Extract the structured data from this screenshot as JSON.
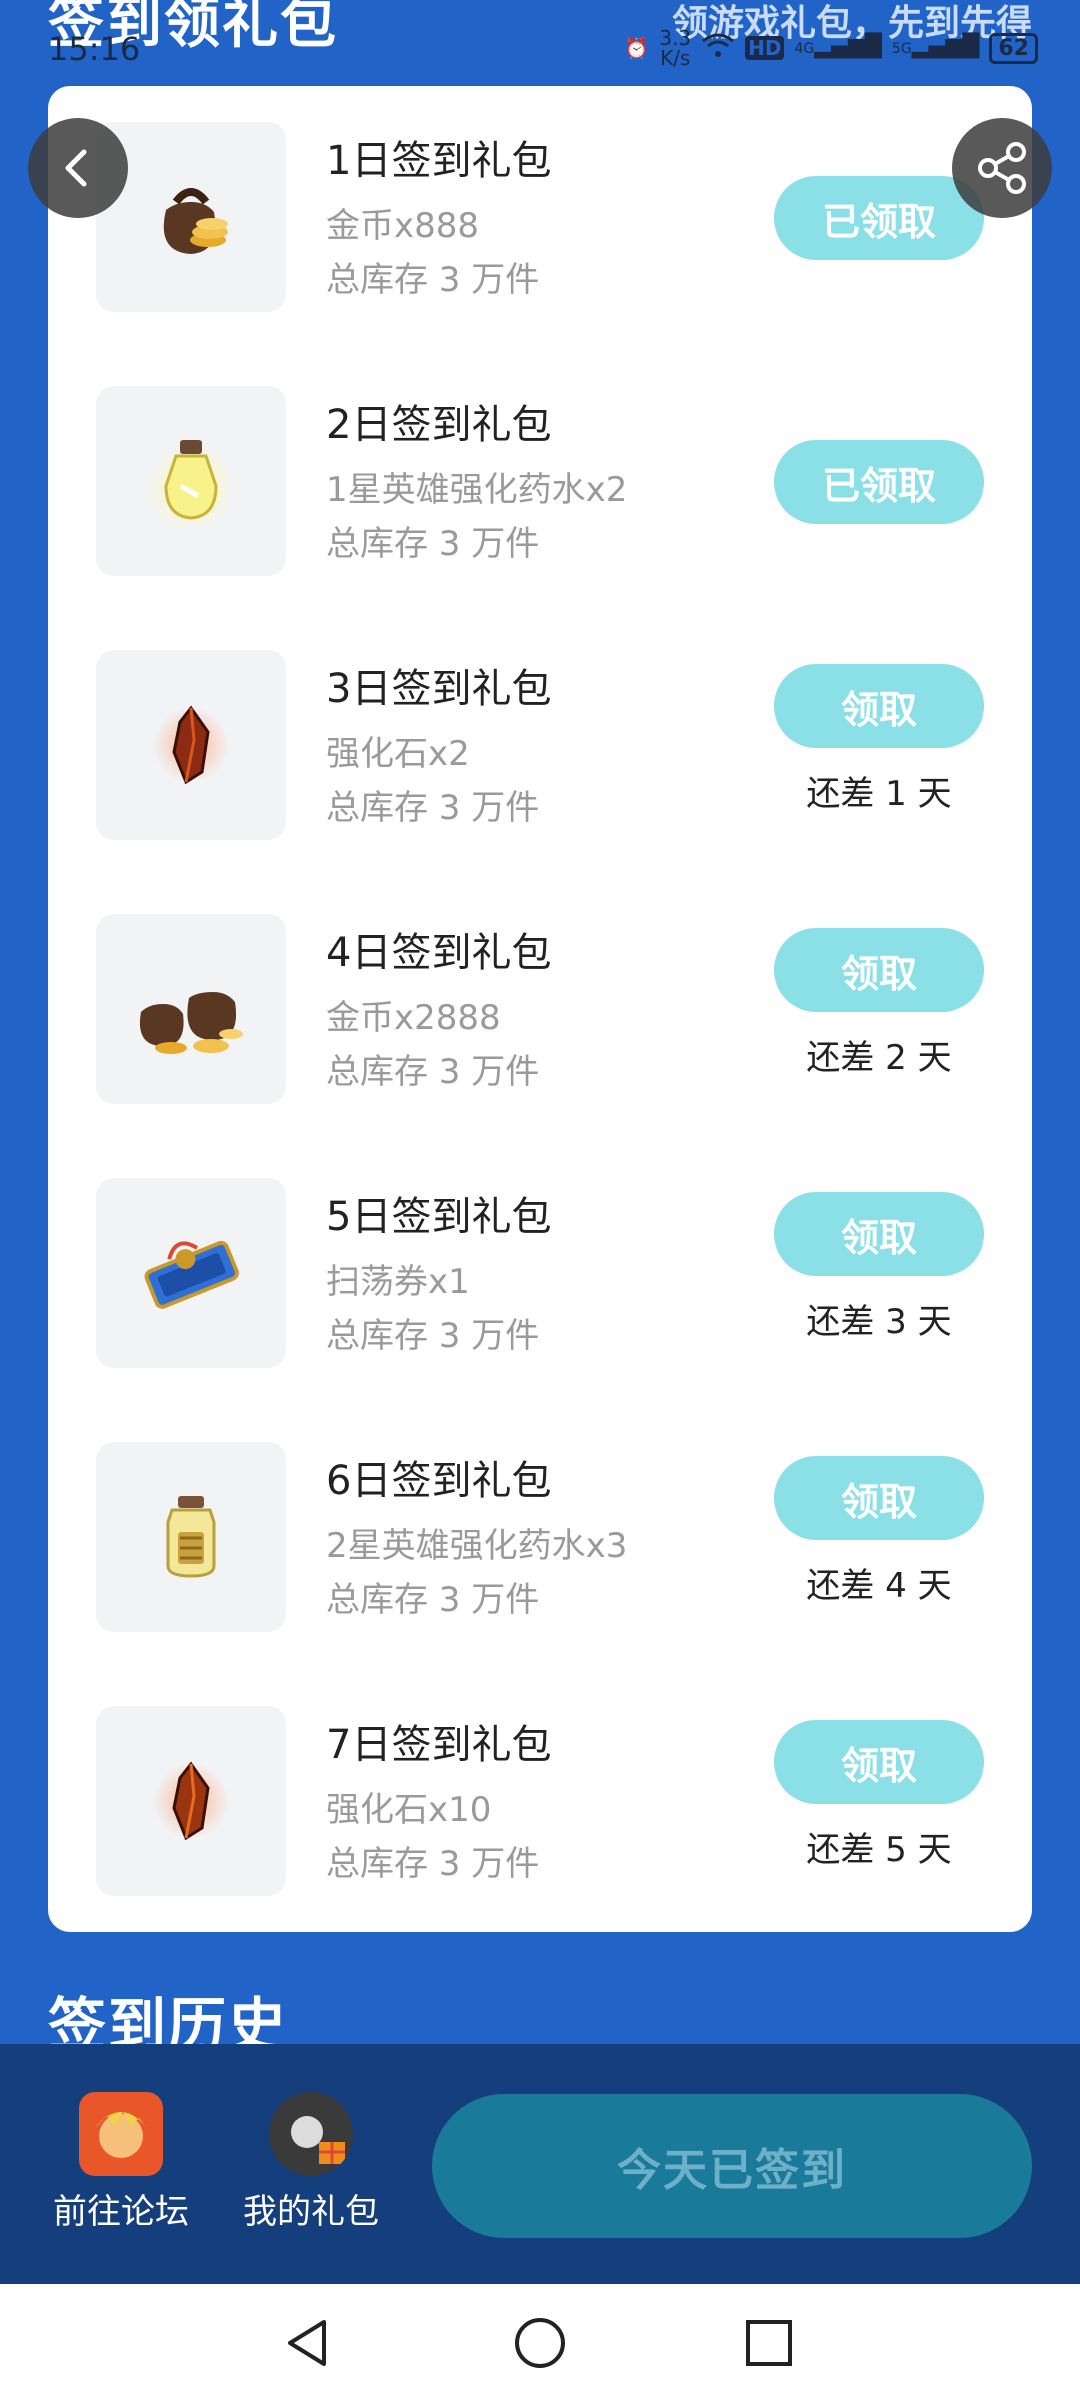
{
  "header": {
    "title": "签到领礼包",
    "promo": "领游戏礼包，先到先得"
  },
  "status_bar": {
    "time": "15:16",
    "speed_value": "3.3",
    "speed_unit": "K/s",
    "hd_label": "HD",
    "network_1": "4G",
    "network_2": "5G",
    "battery": "62"
  },
  "gifts": [
    {
      "title": "1日签到礼包",
      "desc": "金币x888",
      "stock": "总库存 3 万件",
      "button": "已领取",
      "status": "",
      "icon": "coin-bag-icon"
    },
    {
      "title": "2日签到礼包",
      "desc": "1星英雄强化药水x2",
      "stock": "总库存 3 万件",
      "button": "已领取",
      "status": "",
      "icon": "potion-icon"
    },
    {
      "title": "3日签到礼包",
      "desc": "强化石x2",
      "stock": "总库存 3 万件",
      "button": "领取",
      "status": "还差 1 天",
      "icon": "enhance-stone-icon"
    },
    {
      "title": "4日签到礼包",
      "desc": "金币x2888",
      "stock": "总库存 3 万件",
      "button": "领取",
      "status": "还差 2 天",
      "icon": "coin-bags-icon"
    },
    {
      "title": "5日签到礼包",
      "desc": "扫荡券x1",
      "stock": "总库存 3 万件",
      "button": "领取",
      "status": "还差 3 天",
      "icon": "ticket-icon"
    },
    {
      "title": "6日签到礼包",
      "desc": "2星英雄强化药水x3",
      "stock": "总库存 3 万件",
      "button": "领取",
      "status": "还差 4 天",
      "icon": "jar-potion-icon"
    },
    {
      "title": "7日签到礼包",
      "desc": "强化石x10",
      "stock": "总库存 3 万件",
      "button": "领取",
      "status": "还差 5 天",
      "icon": "enhance-stone-icon"
    }
  ],
  "history": {
    "title": "签到历史"
  },
  "bottom": {
    "forum_label": "前往论坛",
    "gifts_label": "我的礼包",
    "checkin_label": "今天已签到"
  },
  "colors": {
    "background": "#2163c6",
    "claim_button": "#8ae0e6",
    "bottom_bar": "#153f7c",
    "checked_button": "#1a7a9a"
  }
}
